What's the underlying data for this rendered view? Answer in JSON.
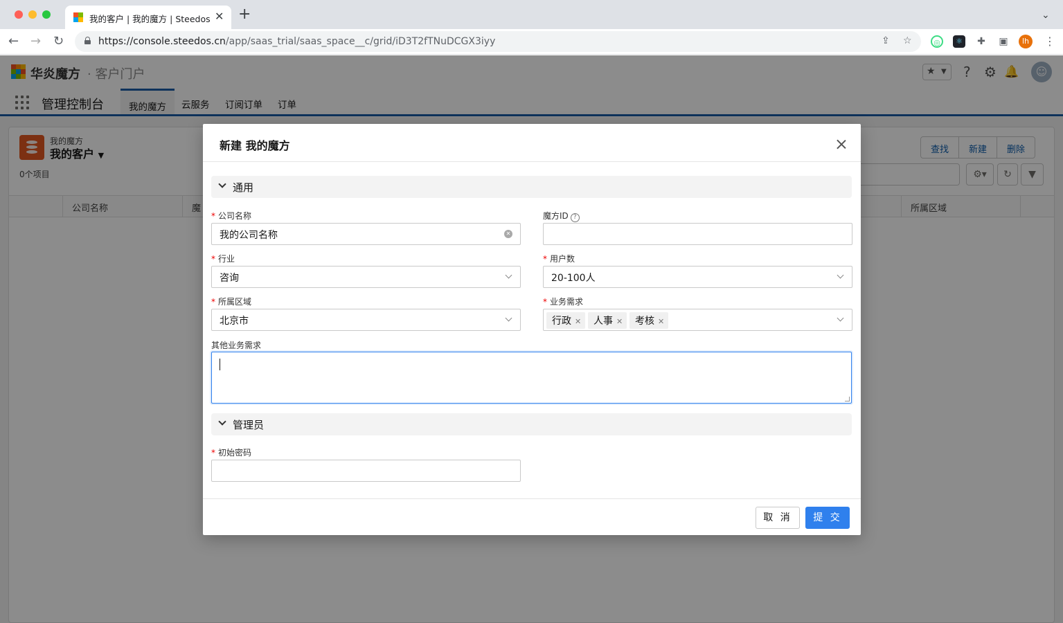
{
  "browser": {
    "tab_title": "我的客户 | 我的魔方 | Steedos",
    "url_host": "https://console.steedos.cn",
    "url_path": "/app/saas_trial/saas_space__c/grid/iD3T2fTNuDCGX3iyy",
    "profile_initial": "lh"
  },
  "app": {
    "logo_text": "华炎魔方",
    "logo_sub": "· 客户门户",
    "name": "管理控制台",
    "tabs": [
      "我的魔方",
      "云服务",
      "订阅订单",
      "订单"
    ],
    "active_tab": 0
  },
  "list": {
    "object_label": "我的魔方",
    "view_title": "我的客户",
    "item_count": "0个项目",
    "actions": [
      "查找",
      "新建",
      "删除"
    ],
    "columns": [
      "公司名称",
      "魔",
      "所属区域"
    ]
  },
  "modal": {
    "title": "新建 我的魔方",
    "section_general": "通用",
    "section_admin": "管理员",
    "fields": {
      "company_name": {
        "label": "公司名称",
        "value": "我的公司名称",
        "required": true
      },
      "cube_id": {
        "label": "魔方ID",
        "value": "",
        "required": false
      },
      "industry": {
        "label": "行业",
        "value": "咨询",
        "required": true
      },
      "user_count": {
        "label": "用户数",
        "value": "20-100人",
        "required": true
      },
      "region": {
        "label": "所属区域",
        "value": "北京市",
        "required": true
      },
      "business_needs": {
        "label": "业务需求",
        "values": [
          "行政",
          "人事",
          "考核"
        ],
        "required": true
      },
      "other_needs": {
        "label": "其他业务需求",
        "value": ""
      },
      "initial_password": {
        "label": "初始密码",
        "value": "",
        "required": true
      }
    },
    "cancel_label": "取 消",
    "submit_label": "提 交"
  },
  "colors": {
    "primary": "#2f80ed",
    "brand_nav": "#1b5ba7",
    "object_icon": "#e25822",
    "required": "#e00000"
  },
  "icons": [
    "lock-icon",
    "share-icon",
    "star-icon",
    "puzzle-icon",
    "sidebar-icon",
    "help-icon",
    "gear-icon",
    "bell-icon",
    "chevron-down-icon",
    "close-icon",
    "clear-icon",
    "refresh-icon",
    "filter-icon"
  ]
}
